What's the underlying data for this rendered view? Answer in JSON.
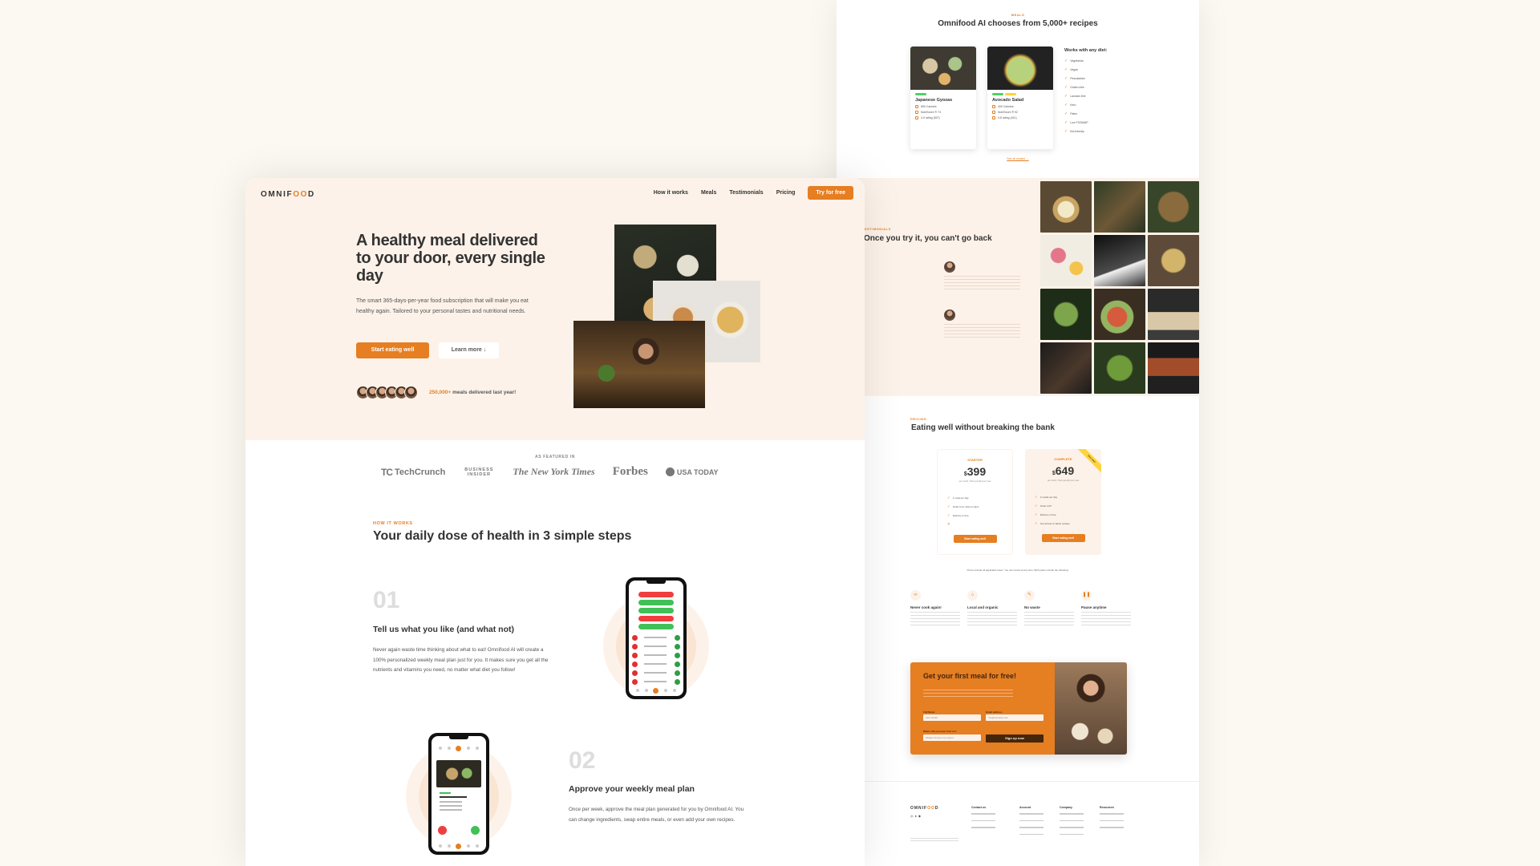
{
  "colors": {
    "accent": "#e67e22",
    "tint": "#fdf2e9",
    "text": "#333333"
  },
  "left": {
    "nav": {
      "logo": "OMNIFOOD",
      "links": [
        "How it works",
        "Meals",
        "Testimonials",
        "Pricing"
      ],
      "cta": "Try for free"
    },
    "hero": {
      "title": "A healthy meal delivered to your door, every single day",
      "description": "The smart 365-days-per-year food subscription that will make you eat healthy again. Tailored to your personal tastes and nutritional needs.",
      "primary_button": "Start eating well",
      "secondary_button": "Learn more ↓",
      "delivered_count": "250,000+",
      "delivered_text": "meals delivered last year!"
    },
    "featured": {
      "label": "AS FEATURED IN",
      "logos": [
        "TechCrunch",
        "BUSINESS INSIDER",
        "The New York Times",
        "Forbes",
        "USA TODAY"
      ]
    },
    "how": {
      "subheading": "HOW IT WORKS",
      "title": "Your daily dose of health in 3 simple steps",
      "steps": [
        {
          "number": "01",
          "title": "Tell us what you like (and what not)",
          "description": "Never again waste time thinking about what to eat! Omnifood AI will create a 100% personalized weekly meal plan just for you. It makes sure you get all the nutrients and vitamins you need, no matter what diet you follow!"
        },
        {
          "number": "02",
          "title": "Approve your weekly meal plan",
          "description": "Once per week, approve the meal plan generated for you by Omnifood AI. You can change ingredients, swap entire meals, or even add your own recipes."
        }
      ]
    }
  },
  "right": {
    "meals": {
      "subheading": "MEALS",
      "title": "Omnifood AI chooses from 5,000+ recipes",
      "cards": [
        {
          "name": "Japanese Gyozas",
          "attrs": [
            "650 Calories",
            "NutriScore ® 74",
            "4.9 rating (537)"
          ]
        },
        {
          "name": "Avocado Salad",
          "attrs": [
            "400 Calories",
            "NutriScore ® 92",
            "4.8 rating (441)"
          ]
        }
      ],
      "diets_title": "Works with any diet:",
      "diets": [
        "Vegetarian",
        "Vegan",
        "Pescatarian",
        "Gluten-free",
        "Lactose-free",
        "Keto",
        "Paleo",
        "Low FODMAP",
        "Kid-friendly"
      ],
      "see_all": "See all recipes →"
    },
    "testimonials": {
      "subheading": "TESTIMONIALS",
      "title": "Once you try it, you can't go back"
    },
    "pricing": {
      "subheading": "PRICING",
      "title": "Eating well without breaking the bank",
      "plans": [
        {
          "name": "STARTER",
          "currency": "$",
          "price": "399",
          "sub": "per month. That's just $13 per meal",
          "features": [
            "1 meal per day",
            "Order from 11am to 9pm",
            "Delivery is free",
            ""
          ],
          "button": "Start eating well"
        },
        {
          "name": "COMPLETE",
          "currency": "$",
          "price": "649",
          "sub": "per month. That's just $11 per meal",
          "features": [
            "2 meals per day",
            "Order 24/7",
            "Delivery is free",
            "Get access to latest recipes"
          ],
          "button": "Start eating well",
          "ribbon": "Best value"
        }
      ],
      "note": "Prices include all applicable taxes. You can cancel at any time. Both plans include the following:",
      "features": [
        {
          "icon": "∞",
          "title": "Never cook again!"
        },
        {
          "icon": "⌂",
          "title": "Local and organic"
        },
        {
          "icon": "✎",
          "title": "No waste"
        },
        {
          "icon": "❚❚",
          "title": "Pause anytime"
        }
      ]
    },
    "cta": {
      "title": "Get your first meal for free!",
      "full_name_label": "Full Name",
      "full_name_placeholder": "John Smith",
      "email_label": "Email address",
      "email_placeholder": "me@example.com",
      "source_label": "Where did you hear from us?",
      "source_value": "Please choose one option:",
      "submit": "Sign up now"
    },
    "footer": {
      "logo": "OMNIFOOD",
      "columns": [
        "Contact us",
        "Account",
        "Company",
        "Resources"
      ]
    }
  }
}
